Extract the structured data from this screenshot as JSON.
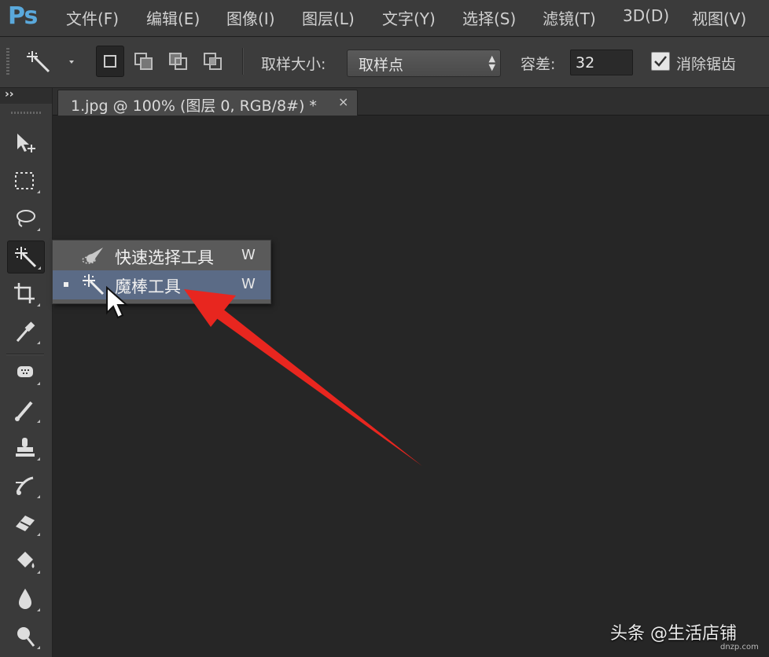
{
  "app": {
    "logo": "Ps"
  },
  "menu": [
    "文件(F)",
    "编辑(E)",
    "图像(I)",
    "图层(L)",
    "文字(Y)",
    "选择(S)",
    "滤镜(T)",
    "3D(D)",
    "视图(V)"
  ],
  "options": {
    "sample_size_label": "取样大小:",
    "sample_size_value": "取样点",
    "tolerance_label": "容差:",
    "tolerance_value": "32",
    "antialias_label": "消除锯齿",
    "antialias_checked": true
  },
  "toolbar": {
    "collapse_glyph": "››",
    "tools": [
      "move-tool-icon",
      "marquee-tool-icon",
      "lasso-tool-icon",
      "magic-wand-tool-icon",
      "crop-tool-icon",
      "eyedropper-tool-icon",
      "spot-healing-tool-icon",
      "brush-tool-icon",
      "clone-stamp-tool-icon",
      "history-brush-tool-icon",
      "eraser-tool-icon",
      "paint-bucket-tool-icon",
      "blur-tool-icon",
      "dodge-tool-icon"
    ],
    "active_tool": "magic-wand-tool-icon"
  },
  "document_tab": {
    "title": "1.jpg @ 100% (图层 0, RGB/8#) *",
    "close": "×"
  },
  "flyout": {
    "items": [
      {
        "label": "快速选择工具",
        "shortcut": "W",
        "icon": "quick-selection-icon",
        "selected": false
      },
      {
        "label": "魔棒工具",
        "shortcut": "W",
        "icon": "magic-wand-icon",
        "selected": true
      }
    ]
  },
  "watermark": {
    "text": "头条 @生活店铺",
    "site": "dnzp.com"
  },
  "colors": {
    "accent_arrow": "#e8261f",
    "selection_highlight": "#5b6b86",
    "canvas": "#262626"
  }
}
